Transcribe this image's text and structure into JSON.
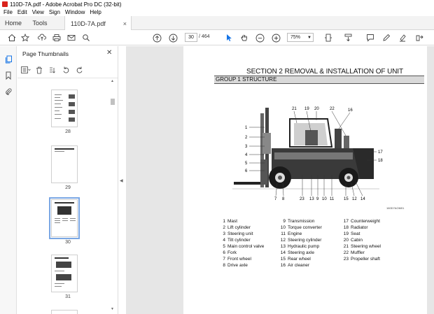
{
  "window": {
    "title": "110D-7A.pdf - Adobe Acrobat Pro DC (32-bit)"
  },
  "menu": [
    "File",
    "Edit",
    "View",
    "Sign",
    "Window",
    "Help"
  ],
  "tabs": {
    "home": "Home",
    "tools": "Tools",
    "document": "110D-7A.pdf",
    "close": "×"
  },
  "toolbar": {
    "current_page": "30",
    "total_pages": "/ 464",
    "zoom": "75%",
    "icons": [
      "home-icon",
      "star-icon",
      "upload-icon",
      "print-icon",
      "mail-icon",
      "search-icon",
      "prev-page-icon",
      "next-page-icon",
      "cursor-icon",
      "hand-icon",
      "zoom-out-icon",
      "zoom-in-icon",
      "fit-icon",
      "scroll-icon",
      "comment-icon",
      "pen-icon",
      "highlight-icon",
      "share-icon"
    ]
  },
  "side_panel": {
    "title": "Page Thumbnails",
    "thumbnails": [
      {
        "label": "28"
      },
      {
        "label": "29"
      },
      {
        "label": "30"
      },
      {
        "label": "31"
      }
    ]
  },
  "document": {
    "section_title": "SECTION 2 REMOVAL & INSTALLATION OF UNIT",
    "group_title": "GROUP 1 STRUCTURE",
    "figure_code": "160D7AOM01",
    "callouts_top": [
      "21",
      "19",
      "20",
      "22",
      "16"
    ],
    "callouts_left": [
      "1",
      "2",
      "3",
      "4",
      "5",
      "6"
    ],
    "callouts_right": [
      "17",
      "18"
    ],
    "callouts_bottom": [
      "7",
      "8",
      "23",
      "13",
      "9",
      "10",
      "11",
      "15",
      "12",
      "14"
    ],
    "parts": [
      [
        {
          "n": "1",
          "name": "Mast"
        },
        {
          "n": "2",
          "name": "Lift cylinder"
        },
        {
          "n": "3",
          "name": "Steering unit"
        },
        {
          "n": "4",
          "name": "Tilt cylinder"
        },
        {
          "n": "5",
          "name": "Main control valve"
        },
        {
          "n": "6",
          "name": "Fork"
        },
        {
          "n": "7",
          "name": "Front wheel"
        },
        {
          "n": "8",
          "name": "Drive axle"
        }
      ],
      [
        {
          "n": "9",
          "name": "Transmission"
        },
        {
          "n": "10",
          "name": "Torque converter"
        },
        {
          "n": "11",
          "name": "Engine"
        },
        {
          "n": "12",
          "name": "Steering cylinder"
        },
        {
          "n": "13",
          "name": "Hydraulic pump"
        },
        {
          "n": "14",
          "name": "Steering axle"
        },
        {
          "n": "15",
          "name": "Rear wheel"
        },
        {
          "n": "16",
          "name": "Air cleaner"
        }
      ],
      [
        {
          "n": "17",
          "name": "Counterweight"
        },
        {
          "n": "18",
          "name": "Radiator"
        },
        {
          "n": "19",
          "name": "Seat"
        },
        {
          "n": "20",
          "name": "Cabin"
        },
        {
          "n": "21",
          "name": "Steering wheel"
        },
        {
          "n": "22",
          "name": "Muffler"
        },
        {
          "n": "23",
          "name": "Propeller shaft"
        }
      ]
    ]
  },
  "colors": {
    "accent": "#1473e6",
    "app_red": "#d9221c",
    "selected_outline": "#7aa7e4"
  }
}
